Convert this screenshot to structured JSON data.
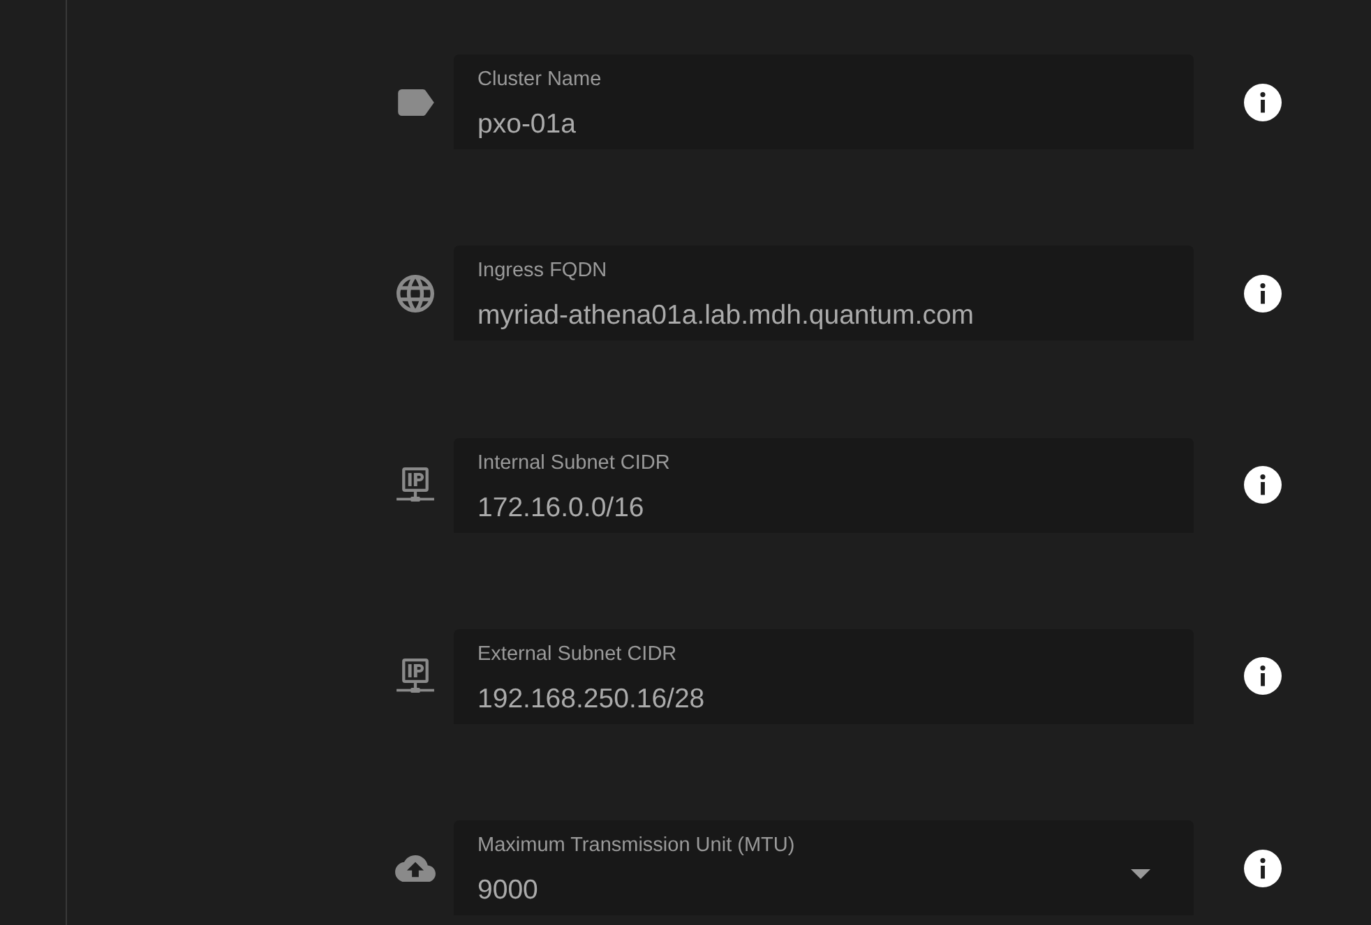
{
  "fields": [
    {
      "kind": "text",
      "label": "Cluster Name",
      "value": "pxo-01a"
    },
    {
      "kind": "text",
      "label": "Ingress FQDN",
      "value": "myriad-athena01a.lab.mdh.quantum.com"
    },
    {
      "kind": "text",
      "label": "Internal Subnet CIDR",
      "value": "172.16.0.0/16"
    },
    {
      "kind": "text",
      "label": "External Subnet CIDR",
      "value": "192.168.250.16/28"
    },
    {
      "kind": "select",
      "label": "Maximum Transmission Unit (MTU)",
      "value": "9000"
    }
  ]
}
